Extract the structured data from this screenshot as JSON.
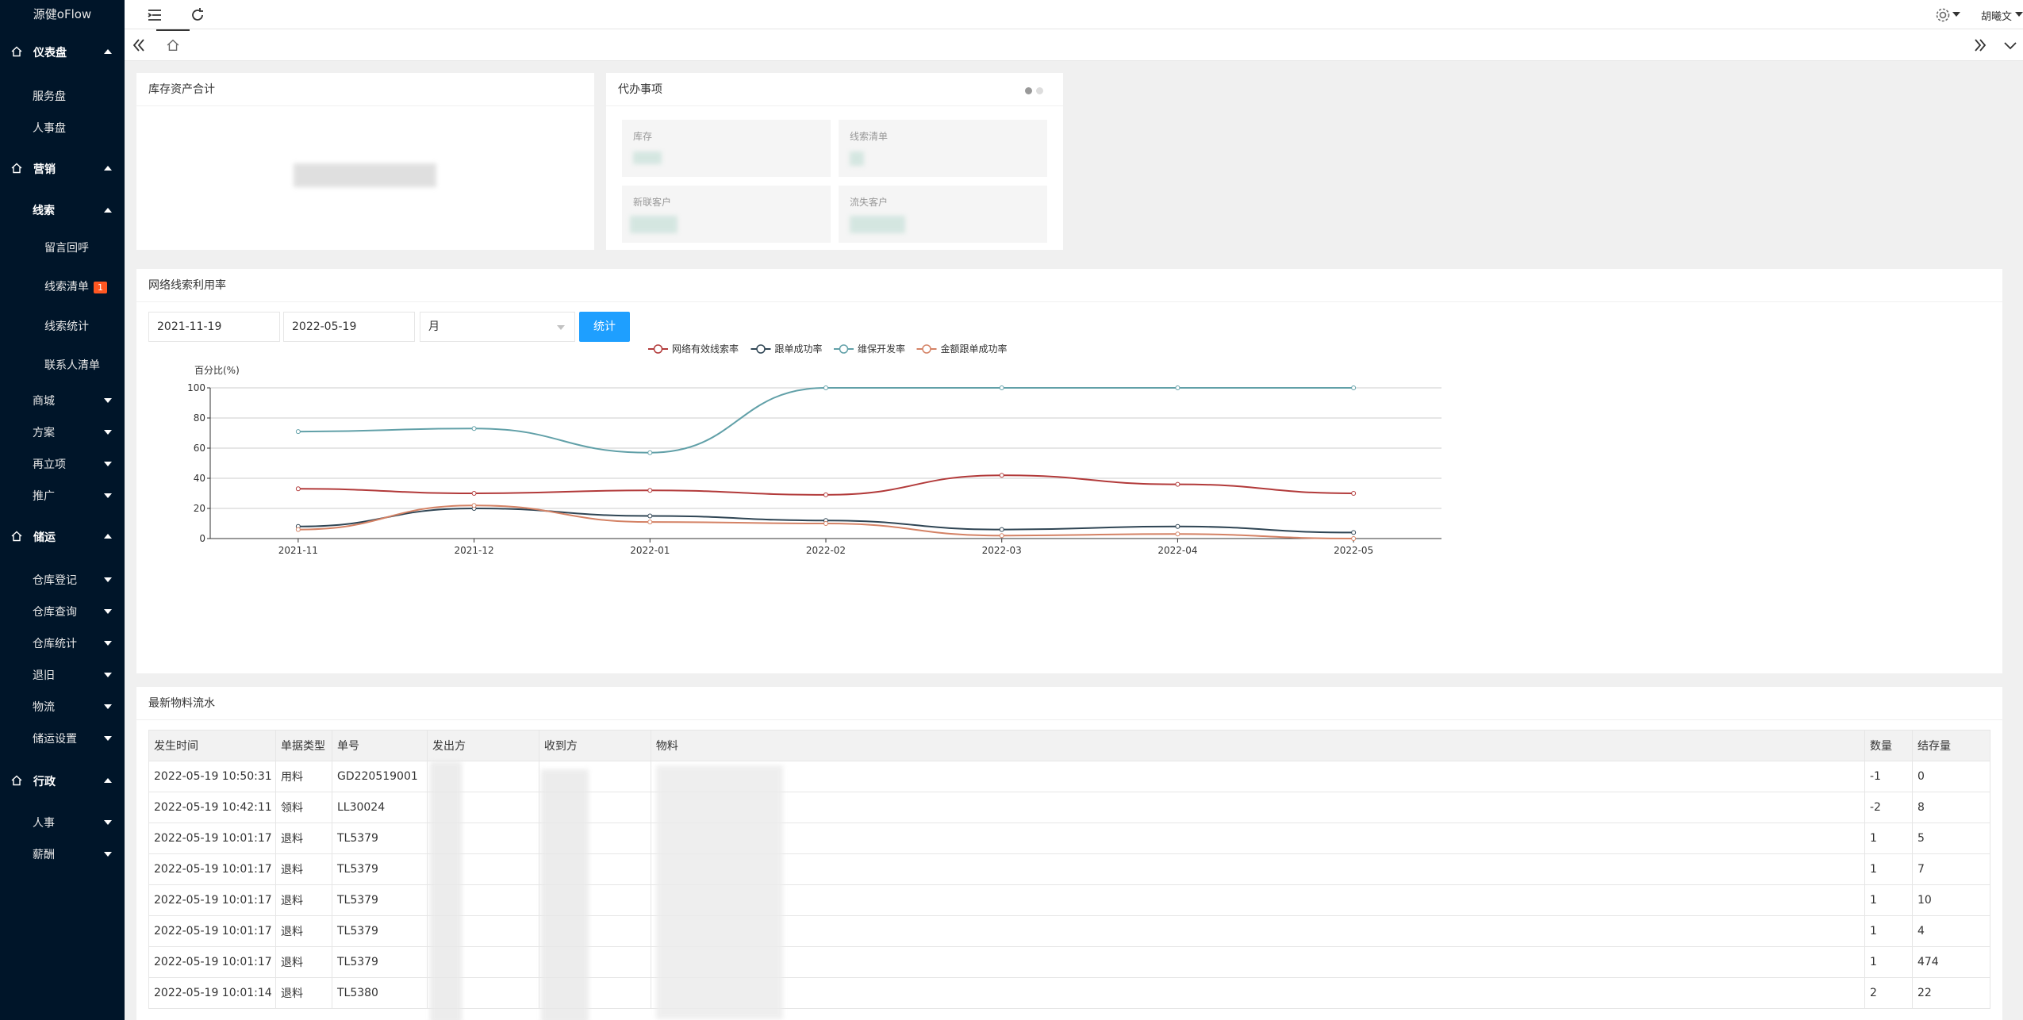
{
  "app": {
    "brand": "源健oFlow"
  },
  "sidebar": {
    "groups": [
      {
        "label": "仪表盘",
        "items": [
          "服务盘",
          "人事盘"
        ]
      },
      {
        "label": "营销",
        "items": [
          "线索",
          "留言回呼",
          "线索清单",
          "线索统计",
          "联系人清单",
          "商城",
          "方案",
          "再立项",
          "推广"
        ]
      },
      {
        "label": "储运",
        "items": [
          "仓库登记",
          "仓库查询",
          "仓库统计",
          "退旧",
          "物流",
          "储运设置"
        ]
      },
      {
        "label": "行政",
        "items": [
          "人事",
          "薪酬"
        ]
      }
    ],
    "badge": "1"
  },
  "header": {
    "user": "胡曦文"
  },
  "cards": {
    "inventory_title": "库存资产合计",
    "todo_title": "代办事项",
    "todo_items": [
      "库存",
      "线索清单",
      "新联客户",
      "流失客户"
    ],
    "chart_title": "网络线索利用率",
    "table_title": "最新物料流水"
  },
  "filter": {
    "start": "2021-11-19",
    "end": "2022-05-19",
    "period": "月",
    "submit": "统计"
  },
  "chart_data": {
    "type": "line",
    "ylabel": "百分比(%)",
    "ylim": [
      0,
      100
    ],
    "yticks": [
      0,
      20,
      40,
      60,
      80,
      100
    ],
    "categories": [
      "2021-11",
      "2021-12",
      "2022-01",
      "2022-02",
      "2022-03",
      "2022-04",
      "2022-05"
    ],
    "legend_position": "top",
    "series": [
      {
        "name": "网络有效线索率",
        "color": "#b23a3a",
        "values": [
          33,
          30,
          32,
          29,
          42,
          36,
          30
        ]
      },
      {
        "name": "跟单成功率",
        "color": "#2f4554",
        "values": [
          8,
          20,
          15,
          12,
          6,
          8,
          4
        ]
      },
      {
        "name": "维保开发率",
        "color": "#61a0a8",
        "values": [
          71,
          73,
          57,
          100,
          100,
          100,
          100
        ]
      },
      {
        "name": "金额跟单成功率",
        "color": "#d48265",
        "values": [
          6,
          22,
          11,
          10,
          2,
          3,
          0
        ]
      }
    ]
  },
  "table": {
    "columns": [
      "发生时间",
      "单据类型",
      "单号",
      "发出方",
      "收到方",
      "物料",
      "数量",
      "结存量"
    ],
    "rows": [
      [
        "2022-05-19 10:50:31",
        "用料",
        "GD220519001",
        "",
        "",
        "",
        "-1",
        "0"
      ],
      [
        "2022-05-19 10:42:11",
        "领料",
        "LL30024",
        "",
        "",
        "",
        "-2",
        "8"
      ],
      [
        "2022-05-19 10:01:17",
        "退料",
        "TL5379",
        "",
        "",
        "",
        "1",
        "5"
      ],
      [
        "2022-05-19 10:01:17",
        "退料",
        "TL5379",
        "",
        "",
        "",
        "1",
        "7"
      ],
      [
        "2022-05-19 10:01:17",
        "退料",
        "TL5379",
        "",
        "",
        "",
        "1",
        "10"
      ],
      [
        "2022-05-19 10:01:17",
        "退料",
        "TL5379",
        "",
        "",
        "",
        "1",
        "4"
      ],
      [
        "2022-05-19 10:01:17",
        "退料",
        "TL5379",
        "",
        "",
        "",
        "1",
        "474"
      ],
      [
        "2022-05-19 10:01:14",
        "退料",
        "TL5380",
        "",
        "",
        "",
        "2",
        "22"
      ]
    ]
  }
}
